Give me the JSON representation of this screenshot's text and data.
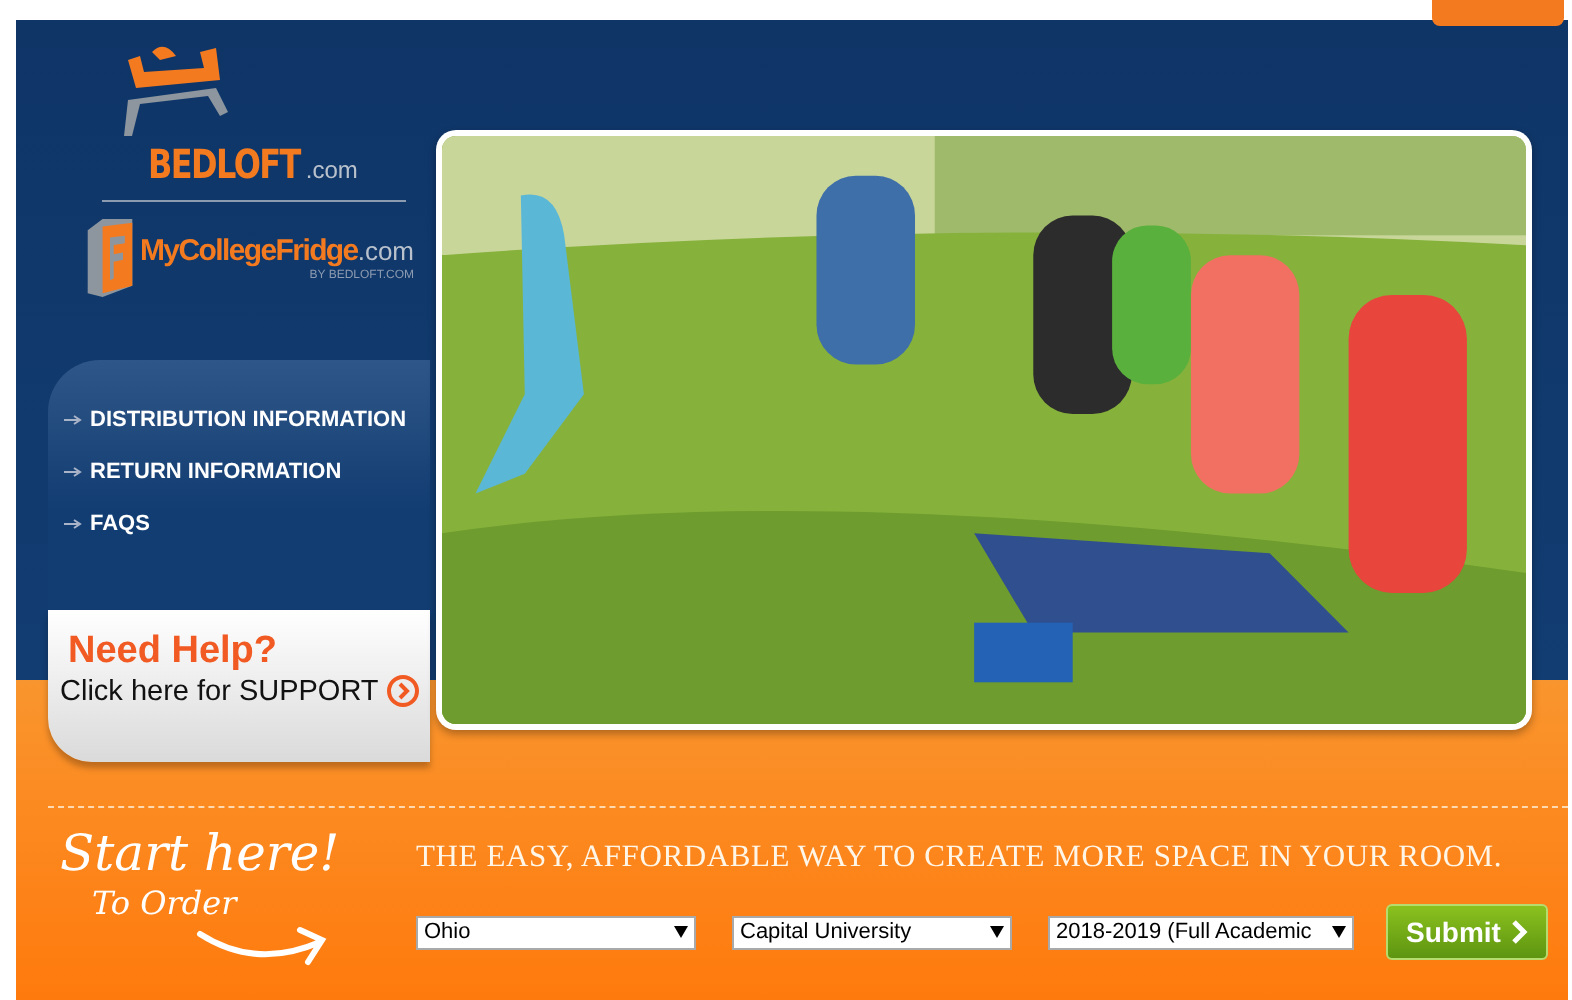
{
  "logos": {
    "bedloft": {
      "name": "BEDLOFT",
      "suffix": ".com"
    },
    "fridge": {
      "name": "MyCollegeFridge",
      "suffix": ".com",
      "byline": "BY BEDLOFT.COM"
    }
  },
  "nav": {
    "items": [
      {
        "label": "DISTRIBUTION INFORMATION"
      },
      {
        "label": "RETURN INFORMATION"
      },
      {
        "label": "FAQS"
      }
    ]
  },
  "help": {
    "title": "Need Help?",
    "link": "Click here for SUPPORT"
  },
  "order": {
    "headline": "Start here!",
    "subline": "To Order",
    "tagline": "THE EASY, AFFORDABLE WAY TO CREATE MORE SPACE IN YOUR ROOM.",
    "fields": [
      {
        "value": "Ohio"
      },
      {
        "value": "Capital University"
      },
      {
        "value": "2018-2019 (Full Academic"
      }
    ],
    "submit": "Submit"
  }
}
